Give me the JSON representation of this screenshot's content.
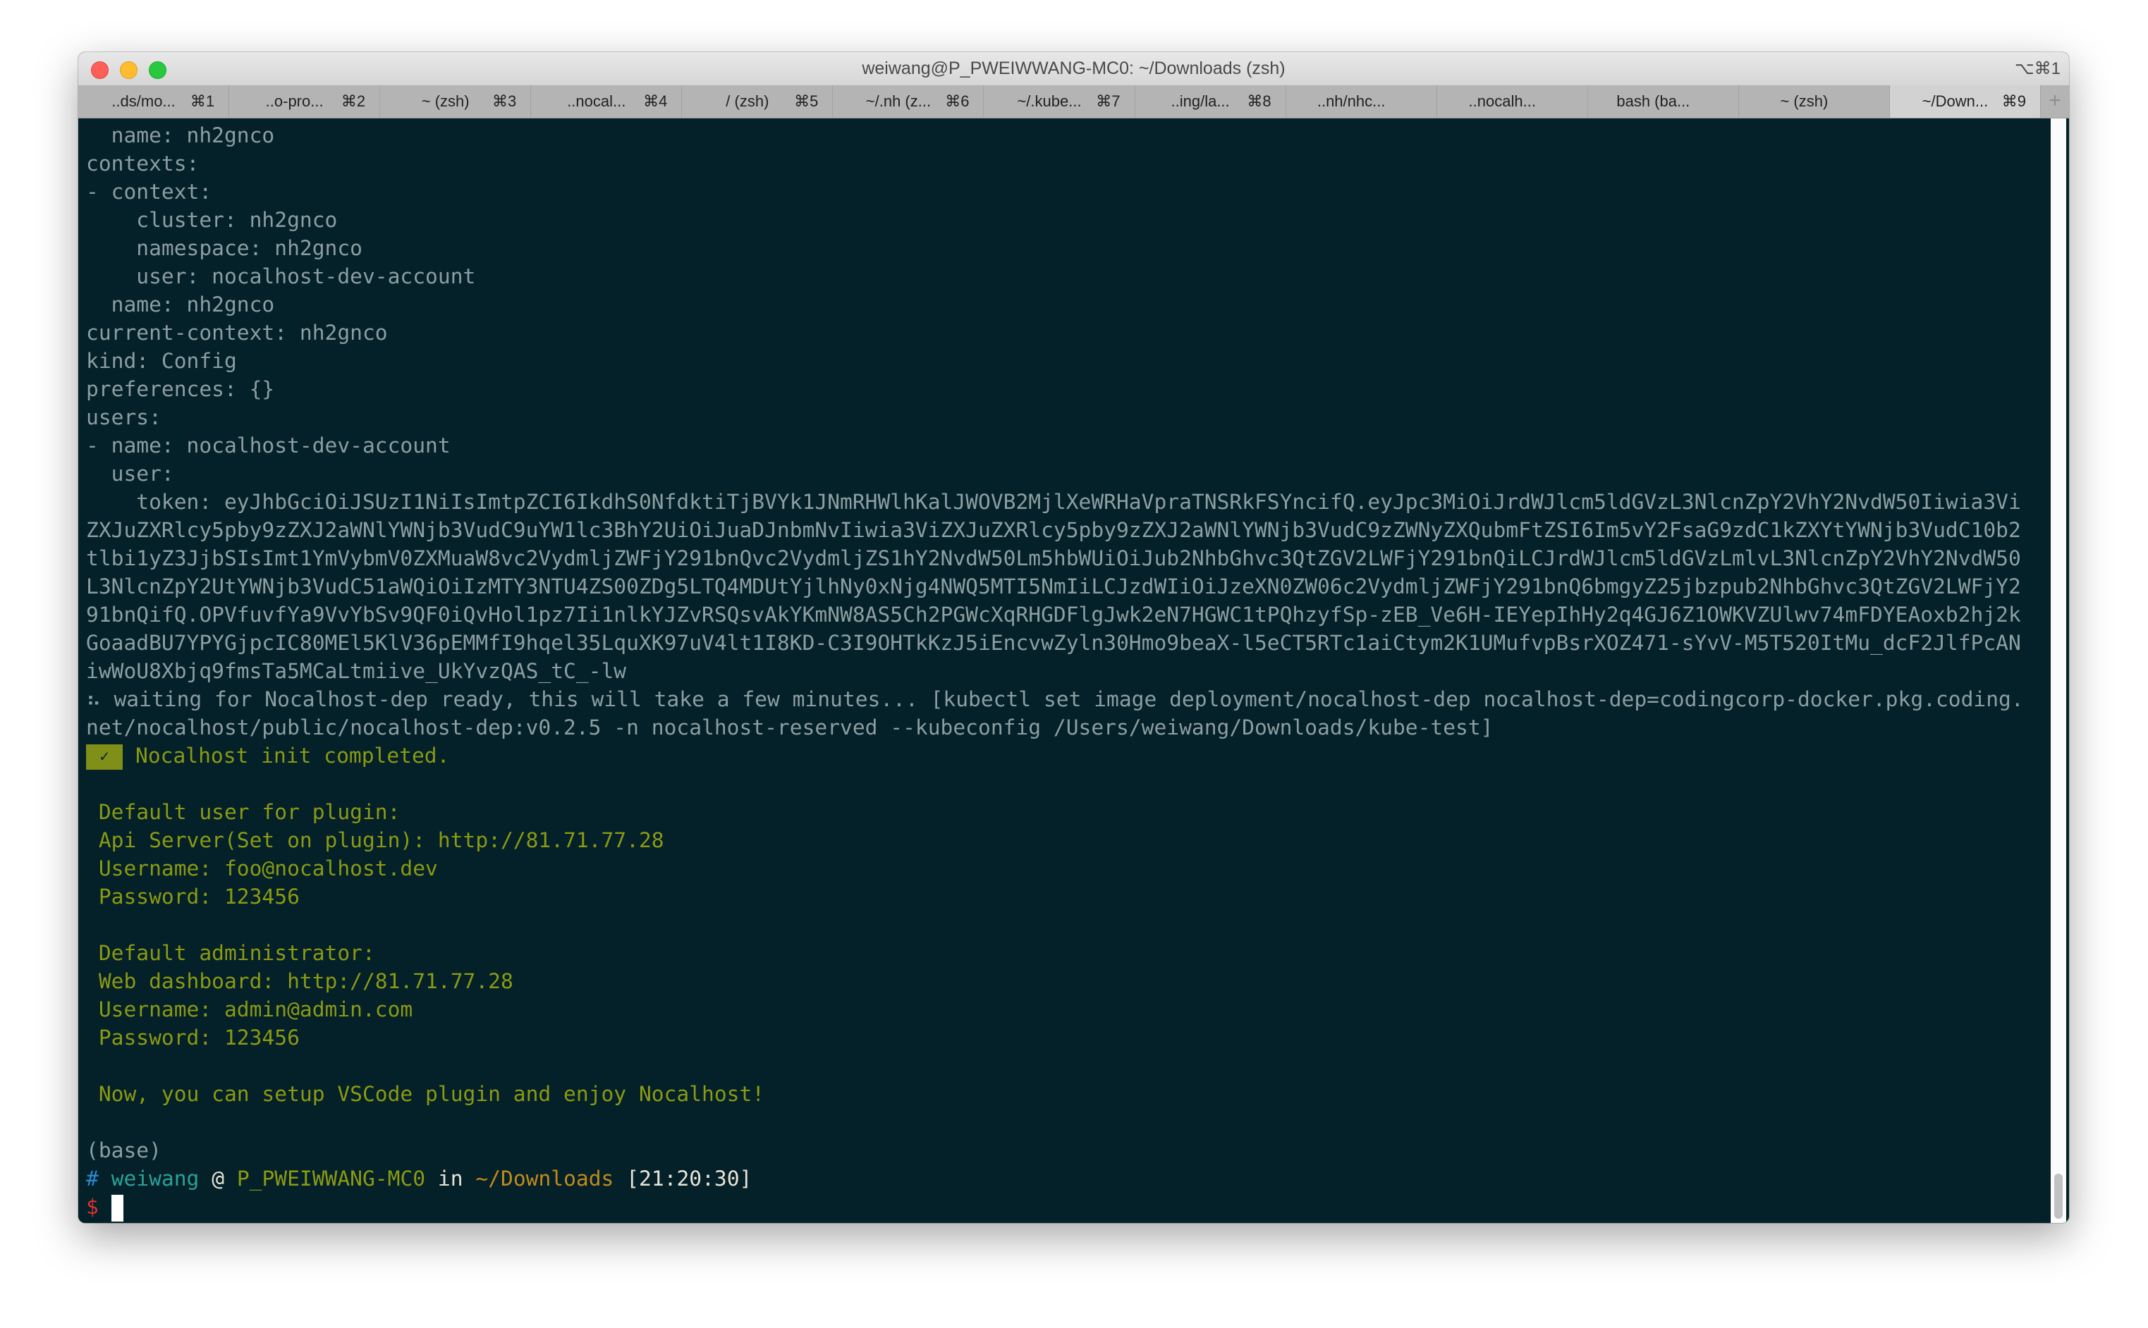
{
  "window": {
    "title": "weiwang@P_PWEIWWANG-MC0: ~/Downloads (zsh)",
    "shortcut": "⌥⌘1"
  },
  "tabs": [
    {
      "label": "..ds/mo...",
      "key": "⌘1"
    },
    {
      "label": "..o-pro...",
      "key": "⌘2"
    },
    {
      "label": "~ (zsh)",
      "key": "⌘3"
    },
    {
      "label": "..nocal...",
      "key": "⌘4"
    },
    {
      "label": "/ (zsh)",
      "key": "⌘5"
    },
    {
      "label": "~/.nh (z...",
      "key": "⌘6"
    },
    {
      "label": "~/.kube...",
      "key": "⌘7"
    },
    {
      "label": "..ing/la...",
      "key": "⌘8"
    },
    {
      "label": "..nh/nhc...",
      "key": ""
    },
    {
      "label": "..nocalh...",
      "key": ""
    },
    {
      "label": "bash (ba...",
      "key": ""
    },
    {
      "label": "~ (zsh)",
      "key": ""
    },
    {
      "label": "~/Down...",
      "key": "⌘9",
      "active": true
    }
  ],
  "new_tab_label": "+",
  "colors": {
    "background": "#042029",
    "text": "#8c9ea0",
    "success": "#8a9a12",
    "path": "#c08b1a",
    "user": "#2aa198",
    "hash": "#268bd2",
    "dollar": "#dc322f"
  },
  "terminal": {
    "lines": [
      [
        {
          "t": "  name: nh2gnco",
          "c": "d"
        }
      ],
      [
        {
          "t": "contexts:",
          "c": "d"
        }
      ],
      [
        {
          "t": "- context:",
          "c": "d"
        }
      ],
      [
        {
          "t": "    cluster: nh2gnco",
          "c": "d"
        }
      ],
      [
        {
          "t": "    namespace: nh2gnco",
          "c": "d"
        }
      ],
      [
        {
          "t": "    user: nocalhost-dev-account",
          "c": "d"
        }
      ],
      [
        {
          "t": "  name: nh2gnco",
          "c": "d"
        }
      ],
      [
        {
          "t": "current-context: nh2gnco",
          "c": "d"
        }
      ],
      [
        {
          "t": "kind: Config",
          "c": "d"
        }
      ],
      [
        {
          "t": "preferences: {}",
          "c": "d"
        }
      ],
      [
        {
          "t": "users:",
          "c": "d"
        }
      ],
      [
        {
          "t": "- name: nocalhost-dev-account",
          "c": "d"
        }
      ],
      [
        {
          "t": "  user:",
          "c": "d"
        }
      ],
      [
        {
          "t": "    token: eyJhbGciOiJSUzI1NiIsImtpZCI6IkdhS0NfdktiTjBVYk1JNmRHWlhKalJWOVB2MjlXeWRHaVpraTNSRkFSYncifQ.eyJpc3MiOiJrdWJlcm5ldGVzL3NlcnZpY2VhY2NvdW50Iiwia3Vi",
          "c": "d"
        }
      ],
      [
        {
          "t": "ZXJuZXRlcy5pby9zZXJ2aWNlYWNjb3VudC9uYW1lc3BhY2UiOiJuaDJnbmNvIiwia3ViZXJuZXRlcy5pby9zZXJ2aWNlYWNjb3VudC9zZWNyZXQubmFtZSI6Im5vY2FsaG9zdC1kZXYtYWNjb3VudC10b2",
          "c": "d"
        }
      ],
      [
        {
          "t": "tlbi1yZ3JjbSIsImt1YmVybmV0ZXMuaW8vc2VydmljZWFjY291bnQvc2VydmljZS1hY2NvdW50Lm5hbWUiOiJub2NhbGhvc3QtZGV2LWFjY291bnQiLCJrdWJlcm5ldGVzLmlvL3NlcnZpY2VhY2NvdW50",
          "c": "d"
        }
      ],
      [
        {
          "t": "L3NlcnZpY2UtYWNjb3VudC51aWQiOiIzMTY3NTU4ZS00ZDg5LTQ4MDUtYjlhNy0xNjg4NWQ5MTI5NmIiLCJzdWIiOiJzeXN0ZW06c2VydmljZWFjY291bnQ6bmgyZ25jbzpub2NhbGhvc3QtZGV2LWFjY2",
          "c": "d"
        }
      ],
      [
        {
          "t": "91bnQifQ.OPVfuvfYa9VvYbSv9QF0iQvHol1pz7Ii1nlkYJZvRSQsvAkYKmNW8AS5Ch2PGWcXqRHGDFlgJwk2eN7HGWC1tPQhzyfSp-zEB_Ve6H-IEYepIhHy2q4GJ6Z1OWKVZUlwv74mFDYEAoxb2hj2k",
          "c": "d"
        }
      ],
      [
        {
          "t": "GoaadBU7YPYGjpcIC80MEl5KlV36pEMMfI9hqel35LquXK97uV4lt1I8KD-C3I9OHTkKzJ5iEncvwZyln30Hmo9beaX-l5eCT5RTc1aiCtym2K1UMufvpBsrXOZ471-sYvV-M5T520ItMu_dcF2JlfPcAN",
          "c": "d"
        }
      ],
      [
        {
          "t": "iwWoU8Xbjq9fmsTa5MCaLtmiive_UkYvzQAS_tC_-lw",
          "c": "d"
        }
      ],
      [
        {
          "t": "⠦ waiting for Nocalhost-dep ready, this will take a few minutes... [kubectl set image deployment/nocalhost-dep nocalhost-dep=codingcorp-docker.pkg.coding.",
          "c": "d"
        }
      ],
      [
        {
          "t": "net/nocalhost/public/nocalhost-dep:v0.2.5 -n nocalhost-reserved --kubeconfig /Users/weiwang/Downloads/kube-test]",
          "c": "d"
        }
      ],
      [
        {
          "t": "✓",
          "c": "badge"
        },
        {
          "t": "Nocalhost init completed.",
          "c": "y"
        }
      ],
      [],
      [
        {
          "t": " Default user for plugin:",
          "c": "y"
        }
      ],
      [
        {
          "t": " Api Server(Set on plugin): http://81.71.77.28",
          "c": "y"
        }
      ],
      [
        {
          "t": " Username: foo@nocalhost.dev",
          "c": "y"
        }
      ],
      [
        {
          "t": " Password: 123456",
          "c": "y"
        }
      ],
      [],
      [
        {
          "t": " Default administrator:",
          "c": "y"
        }
      ],
      [
        {
          "t": " Web dashboard: http://81.71.77.28",
          "c": "y"
        }
      ],
      [
        {
          "t": " Username: admin@admin.com",
          "c": "y"
        }
      ],
      [
        {
          "t": " Password: 123456",
          "c": "y"
        }
      ],
      [],
      [
        {
          "t": " Now, you can setup VSCode plugin and enjoy Nocalhost!",
          "c": "y"
        }
      ],
      [],
      [
        {
          "t": "(base)",
          "c": "d"
        }
      ],
      [
        {
          "t": "#",
          "c": "b"
        },
        {
          "t": " weiwang",
          "c": "c"
        },
        {
          "t": " @ ",
          "c": "w"
        },
        {
          "t": "P_PWEIWWANG-MC0",
          "c": "y"
        },
        {
          "t": " in ",
          "c": "w"
        },
        {
          "t": "~/Downloads",
          "c": "o"
        },
        {
          "t": " [21:20:30]",
          "c": "w"
        }
      ],
      [
        {
          "t": "$ ",
          "c": "r"
        },
        {
          "t": "",
          "c": "cursor"
        }
      ]
    ]
  }
}
